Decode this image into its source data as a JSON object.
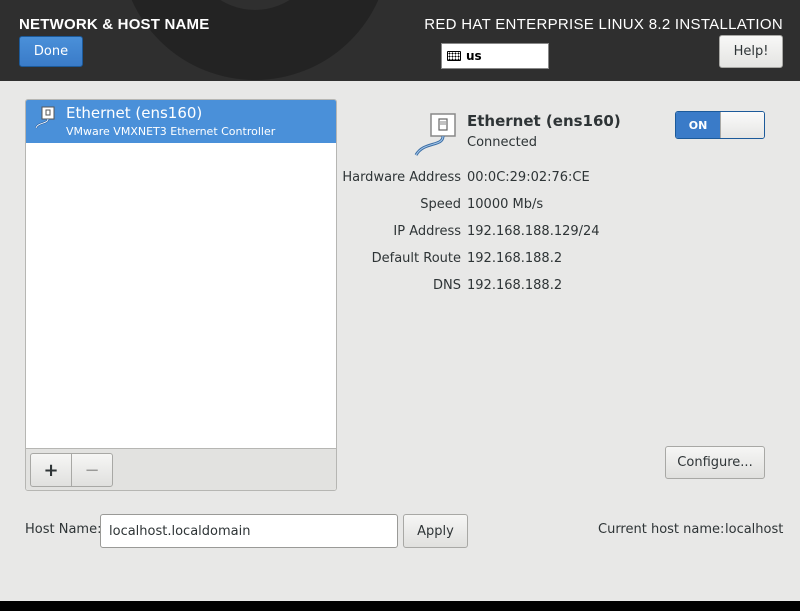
{
  "header": {
    "title": "NETWORK & HOST NAME",
    "done_label": "Done",
    "product": "RED HAT ENTERPRISE LINUX 8.2 INSTALLATION",
    "keyboard_layout": "us",
    "keyboard_icon": "keyboard-icon",
    "help_label": "Help!"
  },
  "device_list": {
    "items": [
      {
        "title": "Ethernet (ens160)",
        "subtitle": "VMware VMXNET3 Ethernet Controller",
        "icon": "ethernet-icon",
        "selected": true
      }
    ],
    "add_label": "+",
    "remove_label": "−"
  },
  "device": {
    "title": "Ethernet (ens160)",
    "status": "Connected",
    "icon": "ethernet-icon",
    "toggle_label": "ON",
    "toggle_state": true,
    "details": [
      {
        "label": "Hardware Address",
        "value": "00:0C:29:02:76:CE"
      },
      {
        "label": "Speed",
        "value": "10000 Mb/s"
      },
      {
        "label": "IP Address",
        "value": "192.168.188.129/24"
      },
      {
        "label": "Default Route",
        "value": "192.168.188.2"
      },
      {
        "label": "DNS",
        "value": "192.168.188.2"
      }
    ],
    "configure_label": "Configure..."
  },
  "hostname": {
    "label": "Host Name:",
    "value": "localhost.localdomain",
    "apply_label": "Apply",
    "current_label": "Current host name:",
    "current_value": "localhost"
  },
  "colors": {
    "accent": "#4a90d9",
    "header_bg": "#2f2f2f",
    "content_bg": "#e8e8e7"
  }
}
